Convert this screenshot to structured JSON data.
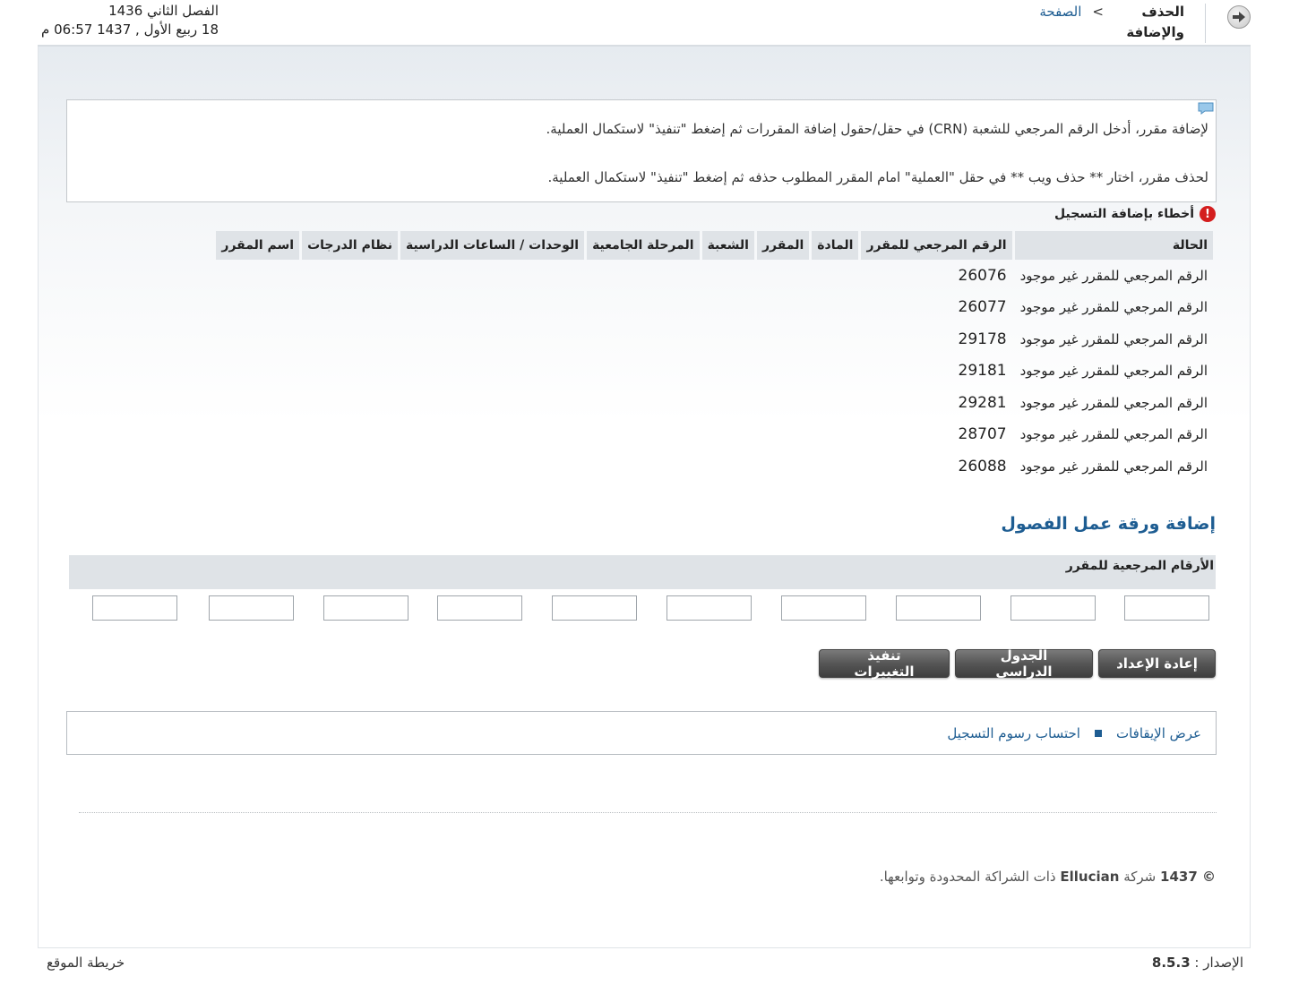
{
  "header": {
    "breadcrumb_home": "الصفحة",
    "breadcrumb_separator": ">",
    "breadcrumb_current": "الحذف والإضافة",
    "term": "الفصل الثاني 1436",
    "datetime": "18 ربيع الأول , 1437 06:57 م",
    "back_icon": "arrow-right-icon"
  },
  "info": {
    "icon": "comment-icon",
    "line1": "لإضافة مقرر، أدخل الرقم المرجعي للشعبة (CRN) في حقل/حقول إضافة المقررات ثم إضغط \"تنفيذ\" لاستكمال العملية.",
    "line2": "لحذف مقرر، اختار ** حذف ويب ** في حقل \"العملية\" امام المقرر المطلوب حذفه ثم إضغط \"تنفيذ\" لاستكمال العملية."
  },
  "errors": {
    "title": "أخطاء بإضافة التسجيل",
    "icon": "error-icon",
    "columns": [
      "الحالة",
      "الرقم المرجعي للمقرر",
      "المادة",
      "المقرر",
      "الشعبة",
      "المرحلة الجامعية",
      "الوحدات / الساعات الدراسية",
      "نظام الدرجات",
      "اسم المقرر"
    ],
    "rows": [
      {
        "status": "الرقم المرجعي للمقرر غير موجود",
        "crn": "26076"
      },
      {
        "status": "الرقم المرجعي للمقرر غير موجود",
        "crn": "26077"
      },
      {
        "status": "الرقم المرجعي للمقرر غير موجود",
        "crn": "29178"
      },
      {
        "status": "الرقم المرجعي للمقرر غير موجود",
        "crn": "29181"
      },
      {
        "status": "الرقم المرجعي للمقرر غير موجود",
        "crn": "29281"
      },
      {
        "status": "الرقم المرجعي للمقرر غير موجود",
        "crn": "28707"
      },
      {
        "status": "الرقم المرجعي للمقرر غير موجود",
        "crn": "26088"
      }
    ]
  },
  "worksheet": {
    "title": "إضافة ورقة عمل الفصول",
    "crn_header": "الأرقام المرجعية للمقرر",
    "inputs": [
      "",
      "",
      "",
      "",
      "",
      "",
      "",
      "",
      "",
      ""
    ]
  },
  "buttons": {
    "submit": "تنفيذ التغييرات",
    "schedule": "الجدول الدراسى",
    "reset": "إعادة الإعداد"
  },
  "links": {
    "holds": "عرض الإيقافات",
    "fees": "احتساب رسوم التسجيل"
  },
  "footer": {
    "copyright_year": "© 1437",
    "copyright_company": "شركة",
    "copyright_brand": "Ellucian",
    "copyright_suffix": "ذات الشراكة المحدودة وتوابعها.",
    "version_label": "الإصدار :",
    "version_value": "8.5.3",
    "sitemap": "خريطة الموقع"
  }
}
